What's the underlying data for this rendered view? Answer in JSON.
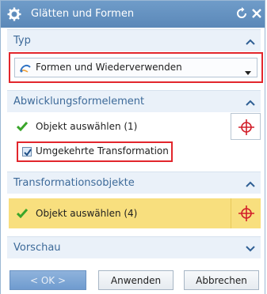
{
  "window": {
    "title": "Glätten und Formen",
    "icons": {
      "app": "gear-icon",
      "reset": "reset-icon",
      "close": "close-icon"
    }
  },
  "sections": {
    "typ": {
      "label": "Typ",
      "collapsed": false,
      "dropdown": {
        "selected": "Formen und Wiederverwenden",
        "icon": "shape-reuse-icon"
      }
    },
    "abwicklung": {
      "label": "Abwicklungsformelement",
      "collapsed": false,
      "select_label": "Objekt auswählen (1)",
      "checkbox": {
        "label": "Umgekehrte Transformation",
        "checked": true
      }
    },
    "transformation": {
      "label": "Transformationsobjekte",
      "collapsed": false,
      "select_label": "Objekt auswählen (4)"
    },
    "vorschau": {
      "label": "Vorschau",
      "collapsed": true
    }
  },
  "buttons": {
    "ok": "< OK >",
    "apply": "Anwenden",
    "cancel": "Abbrechen"
  },
  "colors": {
    "titlebar": "#5b88b8",
    "section_label": "#3d6a99",
    "highlight": "#f8df7e",
    "annotation": "#e2262c",
    "check_green": "#3aa52a",
    "target_red": "#d21f2a"
  }
}
